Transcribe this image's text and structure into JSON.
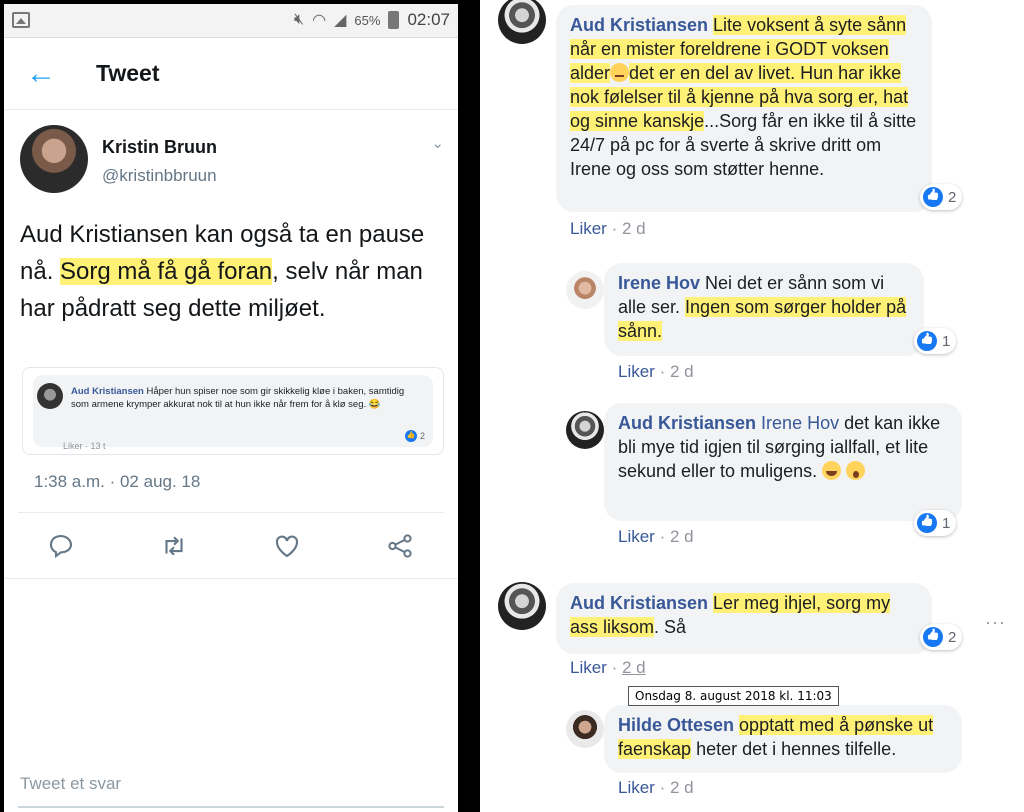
{
  "twitter": {
    "statusbar": {
      "battery": "65%",
      "clock": "02:07"
    },
    "header": {
      "title": "Tweet"
    },
    "author": {
      "name": "Kristin Bruun",
      "handle": "@kristinbbruun"
    },
    "tweet": {
      "text_before": "Aud Kristiansen kan også ta en pause nå. ",
      "text_highlight": "Sorg må få gå foran",
      "text_after": ", selv når man har pådratt seg dette miljøet."
    },
    "quoted": {
      "name": "Aud Kristiansen",
      "text": " Håper hun spiser noe som gir skikkelig kløe i baken, samtidig som armene krymper akkurat nok til at hun ikke når frem for å klø seg. 😂",
      "like": "Liker",
      "time": "13 t",
      "reactions": "2"
    },
    "timestamp": "1:38 a.m. · 02 aug. 18",
    "actions": [
      "reply-icon",
      "retweet-icon",
      "like-icon",
      "share-icon"
    ],
    "reply_placeholder": "Tweet et svar"
  },
  "facebook": {
    "comments": [
      {
        "name": "Aud Kristiansen",
        "text_1": "Lite voksent å syte sånn når en mister foreldrene i GODT voksen alder",
        "text_2": "det er en del av livet. Hun har ikke nok følelser til å kjenne på hva sorg er, hat og sinne kanskje",
        "text_3": "...Sorg får en ikke til å sitte 24/7 på pc for å sverte å skrive dritt om Irene og oss som støtter henne.",
        "like": "Liker",
        "sep": "·",
        "time": "2 d",
        "reactions": "2"
      },
      {
        "name": "Irene Hov",
        "text_1": " Nei det er sånn som vi alle ser. ",
        "text_2": "Ingen som sørger holder på sånn.",
        "like": "Liker",
        "sep": "·",
        "time": "2 d",
        "reactions": "1"
      },
      {
        "name": "Aud Kristiansen",
        "mention": "Irene Hov",
        "text_1": " det kan ikke bli mye tid igjen til sørging iallfall, et lite sekund eller to muligens. ",
        "like": "Liker",
        "sep": "·",
        "time": "2 d",
        "reactions": "1"
      },
      {
        "name": "Aud Kristiansen",
        "text_1": "Ler meg ihjel, sorg my ass liksom",
        "text_2": ". Så",
        "like": "Liker",
        "sep": "·",
        "time": "2 d",
        "reactions": "2"
      },
      {
        "name": "Hilde Ottesen",
        "text_1": "opptatt med å pønske ut faenskap",
        "text_2": " heter det i hennes tilfelle.",
        "like": "Liker",
        "sep": "·",
        "time": "2 d"
      }
    ],
    "tooltip": "Onsdag 8. august 2018 kl. 11:03",
    "more": "···"
  },
  "colors": {
    "highlight": "#fff176",
    "twitter_blue": "#1da1f2",
    "fb_name": "#385898",
    "like_blue": "#1877f2"
  }
}
